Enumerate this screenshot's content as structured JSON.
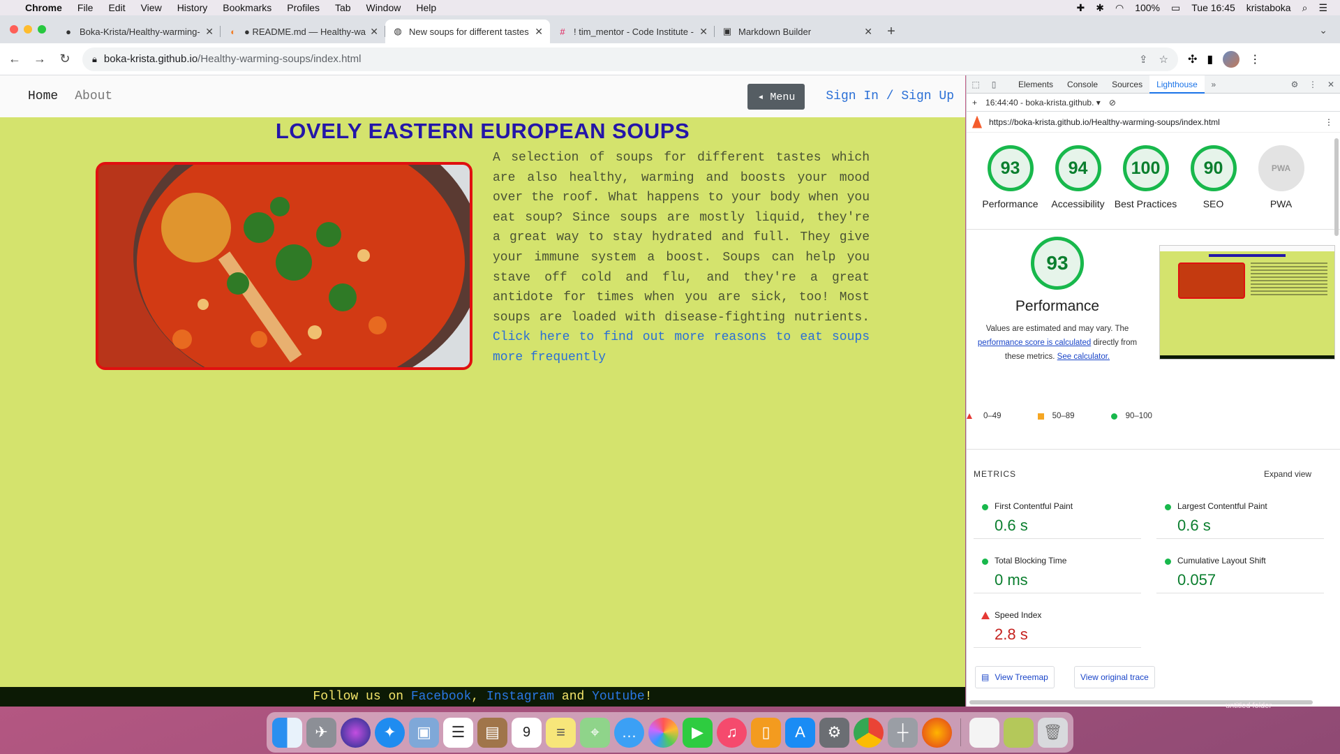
{
  "menubar": {
    "app": "Chrome",
    "items": [
      "File",
      "Edit",
      "View",
      "History",
      "Bookmarks",
      "Profiles",
      "Tab",
      "Window",
      "Help"
    ],
    "battery": "100%",
    "clock": "Tue 16:45",
    "user": "kristaboka"
  },
  "tabs": [
    {
      "title": "Boka-Krista/Healthy-warming-",
      "icon": "github-icon"
    },
    {
      "title": "● README.md — Healthy-war",
      "icon": "gitpod-icon"
    },
    {
      "title": "New soups for different tastes",
      "icon": "globe-icon",
      "active": true
    },
    {
      "title": "! tim_mentor - Code Institute -",
      "icon": "slack-icon"
    },
    {
      "title": "Markdown Builder",
      "icon": "markdown-icon"
    }
  ],
  "toolbar": {
    "url_host": "boka-krista.github.io",
    "url_path": "/Healthy-warming-soups/index.html"
  },
  "site": {
    "nav_home": "Home",
    "nav_about": "About",
    "menu_label": "◂ Menu",
    "sign": "Sign In / Sign Up",
    "title": "LOVELY EASTERN EUROPEAN SOUPS",
    "description": "A selection of soups for different tastes which are also healthy, warming and boosts your mood over the roof. What happens to your body when you eat soup? Since soups are mostly liquid, they're a great way to stay hydrated and full. They give your immune system a boost. Soups can help you stave off cold and flu, and they're a great antidote for times when you are sick, too! Most soups are loaded with disease-fighting nutrients.",
    "link": "Click here to find out more reasons to eat soups more frequently",
    "footer_pre": "Follow us on ",
    "footer_fb": "Facebook",
    "footer_c1": ", ",
    "footer_ig": "Instagram",
    "footer_and": " and ",
    "footer_yt": "Youtube",
    "footer_end": "!"
  },
  "devtools": {
    "tabs": [
      "Elements",
      "Console",
      "Sources",
      "Lighthouse"
    ],
    "report": "16:44:40 - boka-krista.github.",
    "url": "https://boka-krista.github.io/Healthy-warming-soups/index.html",
    "scores": [
      {
        "label": "Performance",
        "score": "93"
      },
      {
        "label": "Accessibility",
        "score": "94"
      },
      {
        "label": "Best Practices",
        "score": "100"
      },
      {
        "label": "SEO",
        "score": "90"
      },
      {
        "label": "PWA",
        "score": "PWA"
      }
    ],
    "perf_score": "93",
    "perf_title": "Performance",
    "note_a": "Values are estimated and may vary. The ",
    "note_link1": "performance score is calculated",
    "note_b": " directly from these metrics. ",
    "note_link2": "See calculator.",
    "legend": [
      "0–49",
      "50–89",
      "90–100"
    ],
    "metrics_heading": "METRICS",
    "expand": "Expand view",
    "metrics": [
      {
        "label": "First Contentful Paint",
        "value": "0.6 s"
      },
      {
        "label": "Largest Contentful Paint",
        "value": "0.6 s"
      },
      {
        "label": "Total Blocking Time",
        "value": "0 ms"
      },
      {
        "label": "Cumulative Layout Shift",
        "value": "0.057"
      },
      {
        "label": "Speed Index",
        "value": "2.8 s"
      }
    ],
    "treemap": "View Treemap",
    "trace": "View original trace"
  },
  "desktop": {
    "folder": "untitled folder"
  }
}
